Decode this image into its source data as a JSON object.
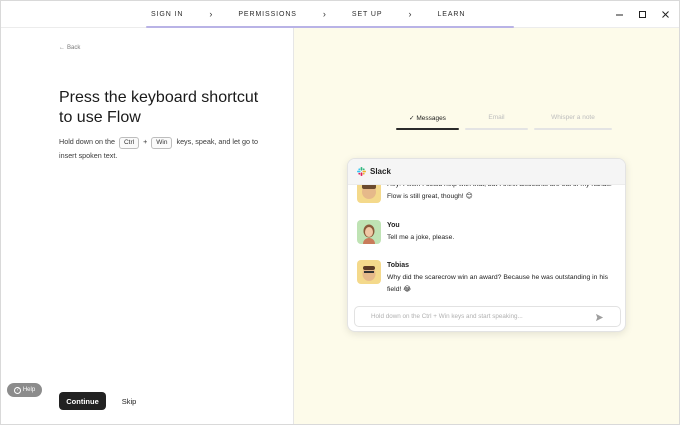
{
  "steps": [
    {
      "label": "SIGN IN"
    },
    {
      "label": "PERMISSIONS"
    },
    {
      "label": "SET UP"
    },
    {
      "label": "LEARN"
    }
  ],
  "window_controls": {
    "minimize": "minimize-icon",
    "maximize": "maximize-icon",
    "close": "close-icon"
  },
  "left": {
    "back_label": "Back",
    "headline": "Press the keyboard shortcut to use Flow",
    "desc_before": "Hold down on the",
    "key1": "Ctrl",
    "plus": "+",
    "key2": "Win",
    "desc_after": "keys, speak, and let go to insert spoken text.",
    "continue_label": "Continue",
    "skip_label": "Skip",
    "help_label": "Help"
  },
  "right": {
    "tabs": [
      {
        "label": "Messages",
        "active": true
      },
      {
        "label": "Email",
        "active": false
      },
      {
        "label": "Whisper a note",
        "active": false
      }
    ],
    "card": {
      "app_name": "Slack",
      "messages": [
        {
          "name": "",
          "text": "Hey! I wish I could help with that, but I think discounts are out of my hands. Flow is still great, though! 😊"
        },
        {
          "name": "You",
          "text": "Tell me a joke, please."
        },
        {
          "name": "Tobias",
          "text": "Why did the scarecrow win an award? Because he was outstanding in his field! 😂"
        }
      ],
      "composer_placeholder": "Hold down on the Ctrl + Win keys and start speaking..."
    }
  },
  "colors": {
    "accent_progress": "#b9b3e6",
    "right_bg": "#fdfbea",
    "button_dark": "#222222"
  }
}
